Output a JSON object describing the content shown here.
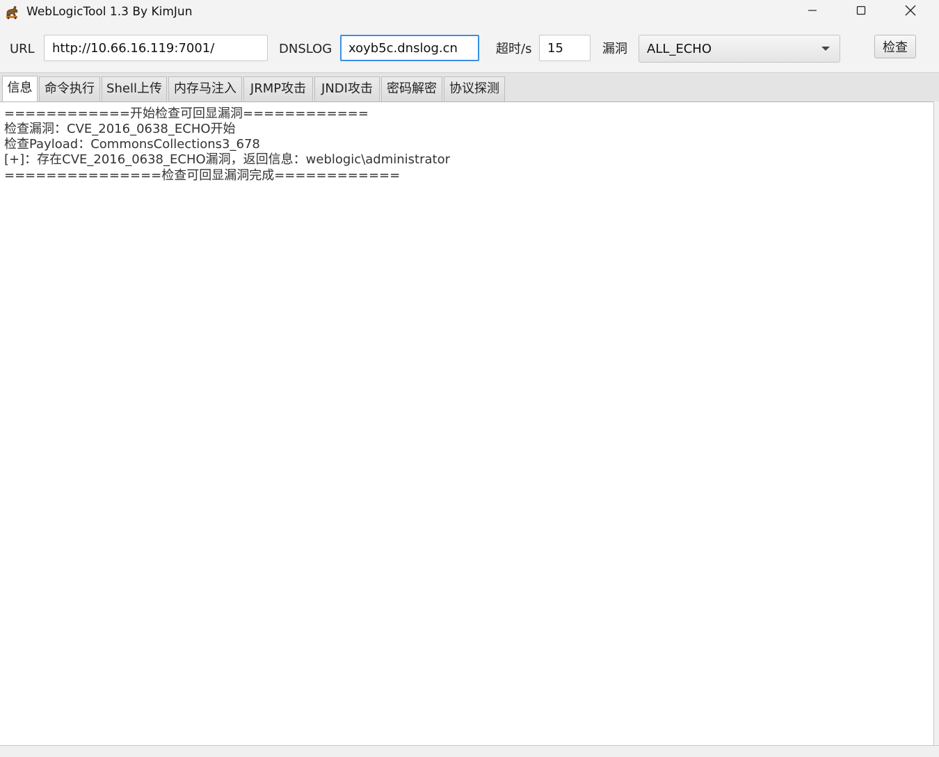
{
  "window": {
    "title": "WebLogicTool 1.3 By KimJun"
  },
  "toolbar": {
    "url_label": "URL",
    "url_value": "http://10.66.16.119:7001/",
    "dnslog_label": "DNSLOG",
    "dnslog_value": "xoyb5c.dnslog.cn",
    "timeout_label": "超时/s",
    "timeout_value": "15",
    "vuln_label": "漏洞",
    "vuln_selected": "ALL_ECHO",
    "check_label": "检查"
  },
  "tabs": [
    {
      "label": "信息",
      "active": true
    },
    {
      "label": "命令执行"
    },
    {
      "label": "Shell上传"
    },
    {
      "label": "内存马注入"
    },
    {
      "label": "JRMP攻击"
    },
    {
      "label": "JNDI攻击"
    },
    {
      "label": "密码解密"
    },
    {
      "label": "协议探测"
    }
  ],
  "log": [
    "============开始检查可回显漏洞============",
    "检查漏洞：CVE_2016_0638_ECHO开始",
    "检查Payload：CommonsCollections3_678",
    "[+]：存在CVE_2016_0638_ECHO漏洞，返回信息：weblogic\\administrator",
    "===============检查可回显漏洞完成============"
  ],
  "colors": {
    "focus_border": "#3a8ee6",
    "content_bg": "#ffffff",
    "chrome_bg": "#f3f3f3"
  },
  "icons": {
    "app": "horse-icon",
    "minimize": "minimize-icon",
    "maximize": "maximize-icon",
    "close": "close-icon",
    "dropdown": "chevron-down-icon"
  }
}
